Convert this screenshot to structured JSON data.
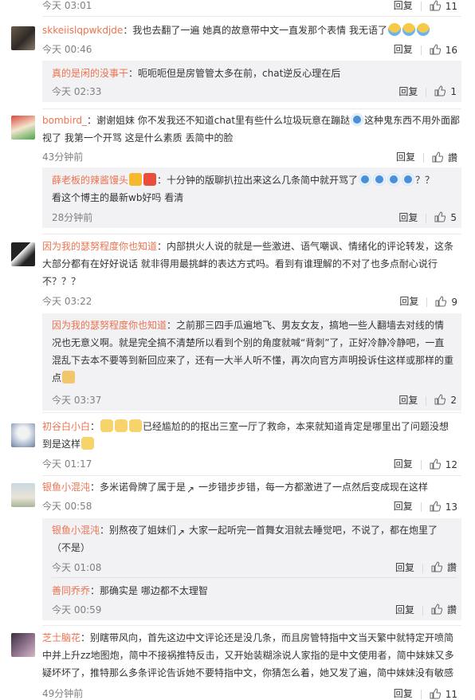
{
  "reply_label": "回复",
  "comments": [
    {
      "time": "今天 03:01",
      "likes": "11"
    },
    {
      "user": "skkeiislqpwkdjde",
      "text": "：我也去翻了一遍 她真的故意带中文一直发那个表情 我无语了",
      "time": "今天 00:46",
      "likes": "16",
      "subs": [
        {
          "user": "真的是闲的没事干",
          "text": "：呃呃呃但是房管管太多在前，chat逆反心理在后",
          "time": "今天 02:33",
          "likes": "1"
        }
      ]
    },
    {
      "user": "bombird_",
      "text1": "：谢谢姐妹 你不发我还不知道chat里有些什么垃圾玩意在蹦跶",
      "text2": "这种鬼东西不用外面鄙",
      "text3": "视了 我第一个开骂 这是什么素质 丢简中的脸",
      "time": "43分钟前",
      "subs": [
        {
          "user": "薛老板的辣酱馒头",
          "text1": "：十分钟的版聊扒拉出来这么几条简中就开骂了",
          "text2": "？？",
          "text3": "看这个博主的最新wb好吗 看清",
          "time": "28分钟前",
          "likes": "5"
        }
      ]
    },
    {
      "user": "因为我的瑟努程度你也知道",
      "text1": "：内部拱火人说的就是一些激进、语气嘲讽、情绪化的评论转发，这条",
      "text2": "大部分都有在好好说话 就非得用最挑衅的表达方式吗。看到有谁理解的不对了也多点耐心说行",
      "text3": "不？？？",
      "time": "今天 03:22",
      "likes": "9",
      "subs": [
        {
          "user": "因为我的瑟努程度你也知道",
          "text1": "：之前那三四手瓜遍地飞、男友女友，搞地一些人翻墙去对线的情",
          "text2": "况也无意义啊。就是完全搞不清楚所以看到个别的角度就喊“背刺”了，正好冷静冷静吧，一直",
          "text3": "混乱下去本不要等到新回应来了，还有一大半人听不懂，再次向官方声明投诉住这样或那样的重",
          "text4": "点",
          "time": "今天 03:37",
          "likes": "2"
        }
      ]
    },
    {
      "user": "初谷白小白",
      "text1": "已经尴尬的的抠出三室一厅了救命，本来就知道肯定是哪里出了问题没想",
      "text2": "到是这样",
      "time": "今天 01:17",
      "likes": "12"
    },
    {
      "user": "银鱼小混沌",
      "text": "：多米诺骨牌了属于是",
      "text_b": "一步错步步错，每一方都激进了一点然后变成现在这样",
      "time": "今天 00:58",
      "likes": "13",
      "subs": [
        {
          "user": "银鱼小混沌",
          "text1": "：别熬夜了姐妹们",
          "text2": "大家一起听完一首舞女泪就去睡觉吧，不说了，都在炮里了",
          "text3": "（不是）",
          "time": "今天 01:08"
        },
        {
          "user": "善同乔乔",
          "text": "：那确实是 哪边都不太理智",
          "time": "今天 00:59"
        }
      ]
    },
    {
      "user": "芝士脑花",
      "text1": "：别瞎带风向，首先这边中文评论还是没几条，而且房管特指中文当天繁中就特定开喷简",
      "text2": "中并上升zz地图炮，简中不接祸推特反击，又开始装糊涂说人家指的是中文使用者，简中妹妹又多",
      "text3": "疑坏坏了，推特那么多条评论告诉她不要特指中文，你猜怎么着，她又发了遍，简中妹妹没有敏感",
      "time": "49分钟前",
      "likes": "11"
    }
  ]
}
